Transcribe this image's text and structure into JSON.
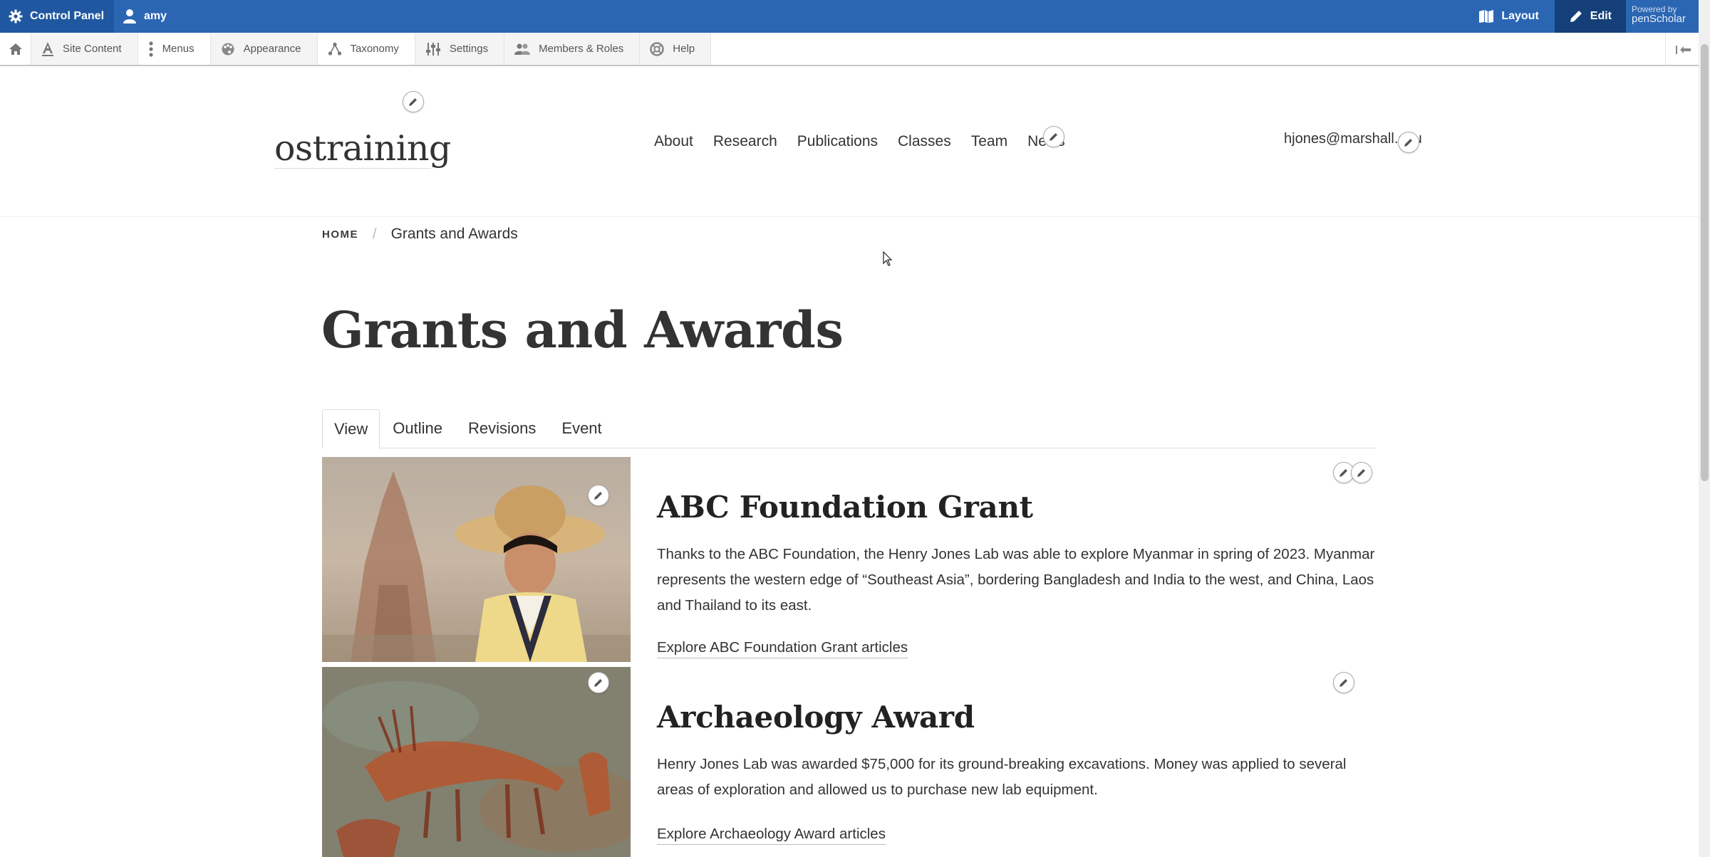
{
  "adminbar": {
    "control_panel": "Control Panel",
    "user": "amy",
    "layout": "Layout",
    "edit": "Edit",
    "powered_line1": "Powered by",
    "powered_line2": "penScholar",
    "bg_color": "#2b66b3"
  },
  "toolbar": {
    "items": [
      {
        "label": "Site Content",
        "icon": "site-content-icon"
      },
      {
        "label": "Menus",
        "icon": "menus-icon"
      },
      {
        "label": "Appearance",
        "icon": "appearance-icon"
      },
      {
        "label": "Taxonomy",
        "icon": "taxonomy-icon"
      },
      {
        "label": "Settings",
        "icon": "settings-icon"
      },
      {
        "label": "Members & Roles",
        "icon": "members-icon"
      },
      {
        "label": "Help",
        "icon": "help-icon"
      }
    ]
  },
  "site": {
    "name": "ostraining",
    "nav": [
      "About",
      "Research",
      "Publications",
      "Classes",
      "Team",
      "News"
    ],
    "email": "hjones@marshall.edu"
  },
  "breadcrumb": {
    "home": "HOME",
    "current": "Grants and Awards"
  },
  "page": {
    "title": "Grants and Awards",
    "tabs": [
      "View",
      "Outline",
      "Revisions",
      "Event"
    ]
  },
  "items": [
    {
      "title": "ABC Foundation Grant",
      "body": "Thanks to the ABC Foundation, the Henry Jones Lab was able to explore Myanmar in spring of 2023. Myanmar represents the western edge of “Southeast Asia”, bordering Bangladesh and India to the west, and China, Laos and Thailand to its east.",
      "link": "Explore ABC Foundation Grant articles"
    },
    {
      "title": "Archaeology Award",
      "body": "Henry Jones Lab was awarded $75,000 for its ground-breaking excavations. Money was applied to several areas of exploration and allowed us to purchase new lab equipment.",
      "link": "Explore Archaeology Award articles"
    }
  ]
}
